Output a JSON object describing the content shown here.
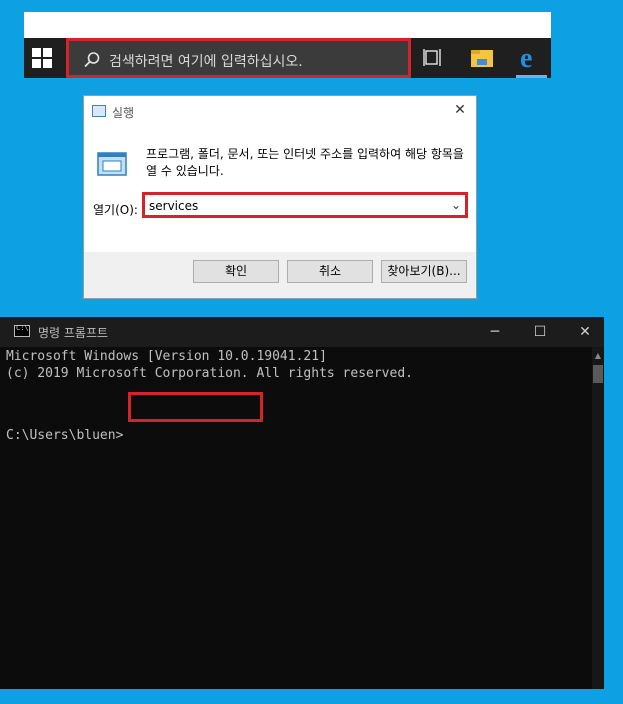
{
  "taskbar": {
    "search_placeholder": "검색하려면 여기에 입력하십시오.",
    "icons": [
      "windows-logo",
      "search",
      "task-view",
      "file-explorer",
      "edge"
    ],
    "edge_glyph": "e"
  },
  "run_dialog": {
    "title": "실행",
    "close_glyph": "✕",
    "description": "프로그램, 폴더, 문서, 또는 인터넷 주소를 입력하여 해당 항목을 열 수 있습니다.",
    "open_label": "열기(O):",
    "input_value": "services",
    "dropdown_glyph": "⌄",
    "buttons": {
      "ok": "확인",
      "cancel": "취소",
      "browse": "찾아보기(B)..."
    }
  },
  "cmd": {
    "title": "명령 프롬프트",
    "controls": {
      "minimize": "─",
      "maximize": "☐",
      "close": "✕"
    },
    "lines": [
      "Microsoft Windows [Version 10.0.19041.21]",
      "(c) 2019 Microsoft Corporation. All rights reserved."
    ],
    "prompt": "C:\\Users\\bluen>",
    "scroll_up_glyph": "▲"
  },
  "colors": {
    "desktop": "#0da0e3",
    "highlight": "#d8222a",
    "taskbar": "#1f1f1f",
    "console_bg": "#0c0c0c",
    "console_text": "#c0c0c0"
  }
}
